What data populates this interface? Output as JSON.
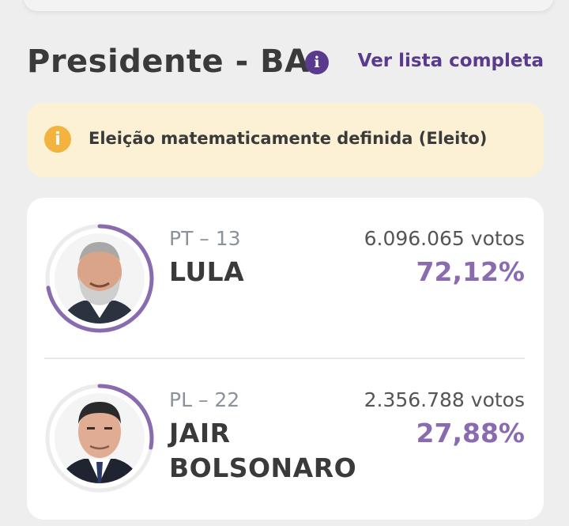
{
  "header": {
    "title": "Presidente - BA",
    "info_icon": "info-icon",
    "link_label": "Ver lista completa"
  },
  "alert": {
    "icon": "info-icon",
    "text": "Eleição matematicamente definida (Eleito)"
  },
  "colors": {
    "accent": "#5a3a8c",
    "percent": "#8a6bb0",
    "alert_bg": "#fcf1d4",
    "alert_icon": "#f2b43e"
  },
  "candidates": [
    {
      "party": "PT – 13",
      "name_lines": [
        "LULA"
      ],
      "votes": "6.096.065 votos",
      "percent": "72,12%",
      "ring_fraction": 0.7212
    },
    {
      "party": "PL – 22",
      "name_lines": [
        "JAIR",
        "BOLSONARO"
      ],
      "votes": "2.356.788 votos",
      "percent": "27,88%",
      "ring_fraction": 0.2788
    }
  ]
}
